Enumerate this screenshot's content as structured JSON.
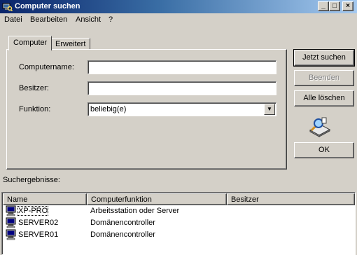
{
  "window": {
    "title": "Computer suchen",
    "controls": [
      "_",
      "□",
      "×"
    ]
  },
  "menu": {
    "items": [
      {
        "label": "Datei",
        "accel": "D"
      },
      {
        "label": "Bearbeiten",
        "accel": "B"
      },
      {
        "label": "Ansicht",
        "accel": "A"
      },
      {
        "label": "?",
        "accel": "?"
      }
    ]
  },
  "tabs": [
    {
      "label": "Computer",
      "active": true
    },
    {
      "label": "Erweitert",
      "active": false
    }
  ],
  "form": {
    "computername_label": "Computername:",
    "computername_value": "",
    "besitzer_label": "Besitzer:",
    "besitzer_value": "",
    "funktion_label": "Funktion:",
    "funktion_value": "beliebig(e)"
  },
  "buttons": {
    "search": "Jetzt suchen",
    "stop": "Beenden",
    "clear": "Alle löschen",
    "ok": "OK"
  },
  "results": {
    "label": "Suchergebnisse:",
    "columns": [
      "Name",
      "Computerfunktion",
      "Besitzer"
    ],
    "rows": [
      {
        "name": "XP-PRO",
        "function": "Arbeitsstation oder Server",
        "owner": ""
      },
      {
        "name": "SERVER02",
        "function": "Domänencontroller",
        "owner": ""
      },
      {
        "name": "SERVER01",
        "function": "Domänencontroller",
        "owner": ""
      }
    ]
  },
  "colors": {
    "title_active": "#0a246a",
    "face": "#d4d0c8"
  }
}
